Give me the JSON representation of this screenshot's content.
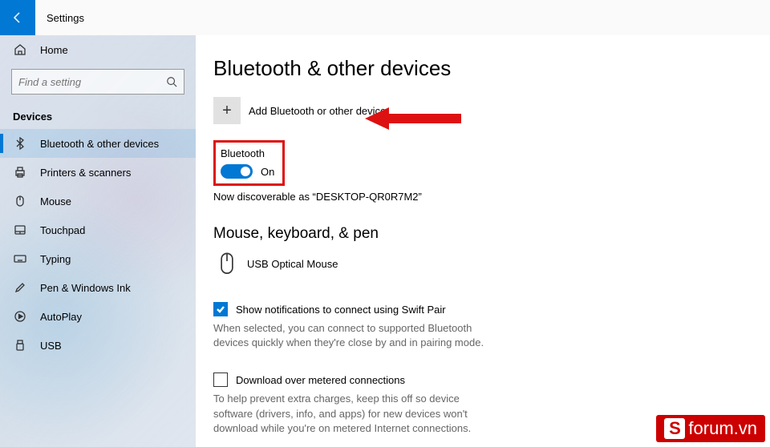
{
  "header": {
    "title": "Settings"
  },
  "search": {
    "placeholder": "Find a setting"
  },
  "sidebar": {
    "home_label": "Home",
    "category": "Devices",
    "items": [
      {
        "label": "Bluetooth & other devices",
        "selected": true
      },
      {
        "label": "Printers & scanners",
        "selected": false
      },
      {
        "label": "Mouse",
        "selected": false
      },
      {
        "label": "Touchpad",
        "selected": false
      },
      {
        "label": "Typing",
        "selected": false
      },
      {
        "label": "Pen & Windows Ink",
        "selected": false
      },
      {
        "label": "AutoPlay",
        "selected": false
      },
      {
        "label": "USB",
        "selected": false
      }
    ]
  },
  "main": {
    "title": "Bluetooth & other devices",
    "add_device": "Add Bluetooth or other device",
    "bluetooth": {
      "label": "Bluetooth",
      "state": "On"
    },
    "discoverable": "Now discoverable as “DESKTOP-QR0R7M2”",
    "section_mkp": "Mouse, keyboard, & pen",
    "device_name": "USB Optical Mouse",
    "swift_pair_label": "Show notifications to connect using Swift Pair",
    "swift_pair_desc": "When selected, you can connect to supported Bluetooth devices quickly when they're close by and in pairing mode.",
    "metered_label": "Download over metered connections",
    "metered_desc": "To help prevent extra charges, keep this off so device software (drivers, info, and apps) for new devices won't download while you're on metered Internet connections."
  },
  "watermark": {
    "text": "forum.vn",
    "badge": "S"
  }
}
